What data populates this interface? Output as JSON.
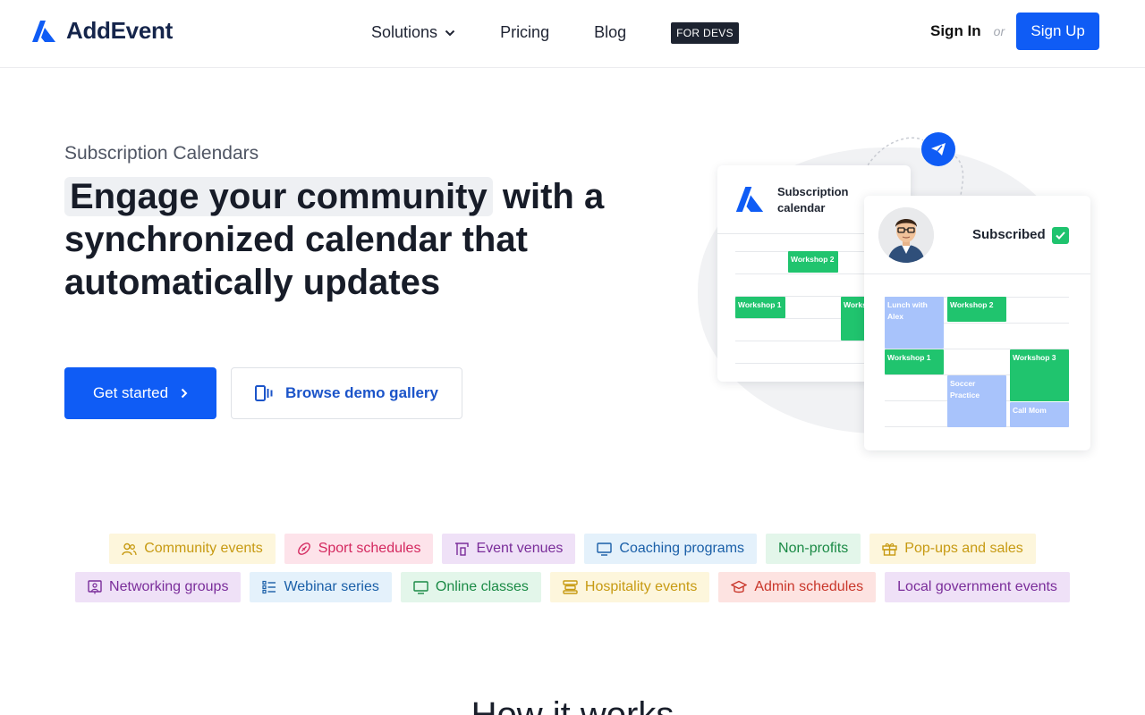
{
  "nav": {
    "brand": "AddEvent",
    "links": [
      {
        "label": "Solutions",
        "has_dropdown": true
      },
      {
        "label": "Pricing"
      },
      {
        "label": "Blog"
      }
    ],
    "dev_badge": "FOR DEVS",
    "sign_in": "Sign In",
    "or": "or",
    "sign_up": "Sign Up"
  },
  "hero": {
    "eyebrow": "Subscription Calendars",
    "headline_highlight": "Engage your community",
    "headline_rest": " with a synchronized calendar that automatically updates",
    "primary_cta": "Get started",
    "secondary_cta": "Browse demo gallery"
  },
  "illustration": {
    "card_title_line1": "Subscription",
    "card_title_line2": "calendar",
    "subscribed_label": "Subscribed",
    "back_events": [
      "Workshop 2",
      "Workshop 1",
      "Workshop"
    ],
    "front_events": [
      "Lunch with Alex",
      "Workshop 2",
      "Workshop 1",
      "Workshop 3",
      "Soccer Practice",
      "Call Mom"
    ]
  },
  "tags": {
    "row1": [
      {
        "label": "Community events",
        "icon": "people-icon",
        "bg": "#fdf6dc",
        "fg": "#c79a12"
      },
      {
        "label": "Sport schedules",
        "icon": "football-icon",
        "bg": "#fde3ea",
        "fg": "#d4285f"
      },
      {
        "label": "Event venues",
        "icon": "venue-icon",
        "bg": "#efe1f7",
        "fg": "#7a2d9a"
      },
      {
        "label": "Coaching programs",
        "icon": "monitor-icon",
        "bg": "#e4f1fb",
        "fg": "#1a5fa8"
      },
      {
        "label": "Non-profits",
        "icon": "",
        "bg": "#e3f6ea",
        "fg": "#1a8a45"
      },
      {
        "label": "Pop-ups and sales",
        "icon": "gift-icon",
        "bg": "#fdf6dc",
        "fg": "#c79a12"
      }
    ],
    "row2": [
      {
        "label": "Networking groups",
        "icon": "presenter-icon",
        "bg": "#efe1f7",
        "fg": "#7a2d9a"
      },
      {
        "label": "Webinar series",
        "icon": "list-icon",
        "bg": "#e4f1fb",
        "fg": "#1a5fa8"
      },
      {
        "label": "Online classes",
        "icon": "monitor-icon",
        "bg": "#e3f6ea",
        "fg": "#1a8a45"
      },
      {
        "label": "Hospitality events",
        "icon": "hospitality-icon",
        "bg": "#fdf6dc",
        "fg": "#c79a12"
      },
      {
        "label": "Admin schedules",
        "icon": "graduation-cap-icon",
        "bg": "#fde3e1",
        "fg": "#c9362a"
      },
      {
        "label": "Local government events",
        "icon": "",
        "bg": "#efe1f7",
        "fg": "#7a2d9a"
      }
    ]
  },
  "how_title": "How it works"
}
